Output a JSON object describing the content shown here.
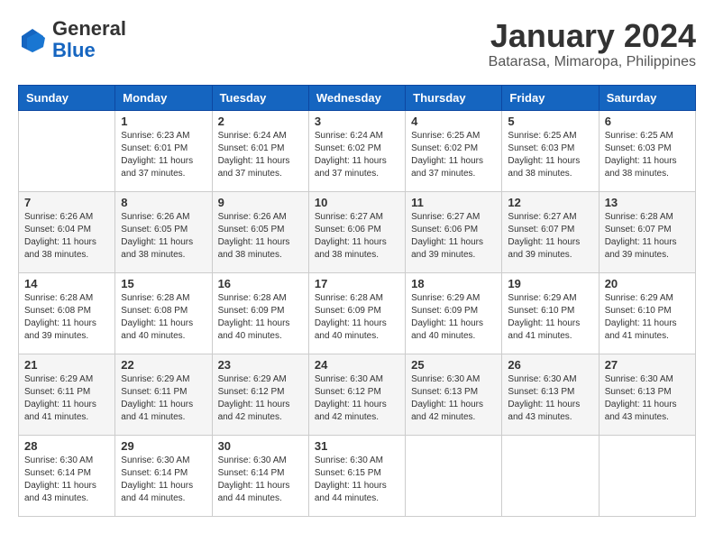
{
  "logo": {
    "general": "General",
    "blue": "Blue"
  },
  "title": "January 2024",
  "location": "Batarasa, Mimaropa, Philippines",
  "days_of_week": [
    "Sunday",
    "Monday",
    "Tuesday",
    "Wednesday",
    "Thursday",
    "Friday",
    "Saturday"
  ],
  "weeks": [
    [
      {
        "day": "",
        "sunrise": "",
        "sunset": "",
        "daylight": ""
      },
      {
        "day": "1",
        "sunrise": "Sunrise: 6:23 AM",
        "sunset": "Sunset: 6:01 PM",
        "daylight": "Daylight: 11 hours and 37 minutes."
      },
      {
        "day": "2",
        "sunrise": "Sunrise: 6:24 AM",
        "sunset": "Sunset: 6:01 PM",
        "daylight": "Daylight: 11 hours and 37 minutes."
      },
      {
        "day": "3",
        "sunrise": "Sunrise: 6:24 AM",
        "sunset": "Sunset: 6:02 PM",
        "daylight": "Daylight: 11 hours and 37 minutes."
      },
      {
        "day": "4",
        "sunrise": "Sunrise: 6:25 AM",
        "sunset": "Sunset: 6:02 PM",
        "daylight": "Daylight: 11 hours and 37 minutes."
      },
      {
        "day": "5",
        "sunrise": "Sunrise: 6:25 AM",
        "sunset": "Sunset: 6:03 PM",
        "daylight": "Daylight: 11 hours and 38 minutes."
      },
      {
        "day": "6",
        "sunrise": "Sunrise: 6:25 AM",
        "sunset": "Sunset: 6:03 PM",
        "daylight": "Daylight: 11 hours and 38 minutes."
      }
    ],
    [
      {
        "day": "7",
        "sunrise": "Sunrise: 6:26 AM",
        "sunset": "Sunset: 6:04 PM",
        "daylight": "Daylight: 11 hours and 38 minutes."
      },
      {
        "day": "8",
        "sunrise": "Sunrise: 6:26 AM",
        "sunset": "Sunset: 6:05 PM",
        "daylight": "Daylight: 11 hours and 38 minutes."
      },
      {
        "day": "9",
        "sunrise": "Sunrise: 6:26 AM",
        "sunset": "Sunset: 6:05 PM",
        "daylight": "Daylight: 11 hours and 38 minutes."
      },
      {
        "day": "10",
        "sunrise": "Sunrise: 6:27 AM",
        "sunset": "Sunset: 6:06 PM",
        "daylight": "Daylight: 11 hours and 38 minutes."
      },
      {
        "day": "11",
        "sunrise": "Sunrise: 6:27 AM",
        "sunset": "Sunset: 6:06 PM",
        "daylight": "Daylight: 11 hours and 39 minutes."
      },
      {
        "day": "12",
        "sunrise": "Sunrise: 6:27 AM",
        "sunset": "Sunset: 6:07 PM",
        "daylight": "Daylight: 11 hours and 39 minutes."
      },
      {
        "day": "13",
        "sunrise": "Sunrise: 6:28 AM",
        "sunset": "Sunset: 6:07 PM",
        "daylight": "Daylight: 11 hours and 39 minutes."
      }
    ],
    [
      {
        "day": "14",
        "sunrise": "Sunrise: 6:28 AM",
        "sunset": "Sunset: 6:08 PM",
        "daylight": "Daylight: 11 hours and 39 minutes."
      },
      {
        "day": "15",
        "sunrise": "Sunrise: 6:28 AM",
        "sunset": "Sunset: 6:08 PM",
        "daylight": "Daylight: 11 hours and 40 minutes."
      },
      {
        "day": "16",
        "sunrise": "Sunrise: 6:28 AM",
        "sunset": "Sunset: 6:09 PM",
        "daylight": "Daylight: 11 hours and 40 minutes."
      },
      {
        "day": "17",
        "sunrise": "Sunrise: 6:28 AM",
        "sunset": "Sunset: 6:09 PM",
        "daylight": "Daylight: 11 hours and 40 minutes."
      },
      {
        "day": "18",
        "sunrise": "Sunrise: 6:29 AM",
        "sunset": "Sunset: 6:09 PM",
        "daylight": "Daylight: 11 hours and 40 minutes."
      },
      {
        "day": "19",
        "sunrise": "Sunrise: 6:29 AM",
        "sunset": "Sunset: 6:10 PM",
        "daylight": "Daylight: 11 hours and 41 minutes."
      },
      {
        "day": "20",
        "sunrise": "Sunrise: 6:29 AM",
        "sunset": "Sunset: 6:10 PM",
        "daylight": "Daylight: 11 hours and 41 minutes."
      }
    ],
    [
      {
        "day": "21",
        "sunrise": "Sunrise: 6:29 AM",
        "sunset": "Sunset: 6:11 PM",
        "daylight": "Daylight: 11 hours and 41 minutes."
      },
      {
        "day": "22",
        "sunrise": "Sunrise: 6:29 AM",
        "sunset": "Sunset: 6:11 PM",
        "daylight": "Daylight: 11 hours and 41 minutes."
      },
      {
        "day": "23",
        "sunrise": "Sunrise: 6:29 AM",
        "sunset": "Sunset: 6:12 PM",
        "daylight": "Daylight: 11 hours and 42 minutes."
      },
      {
        "day": "24",
        "sunrise": "Sunrise: 6:30 AM",
        "sunset": "Sunset: 6:12 PM",
        "daylight": "Daylight: 11 hours and 42 minutes."
      },
      {
        "day": "25",
        "sunrise": "Sunrise: 6:30 AM",
        "sunset": "Sunset: 6:13 PM",
        "daylight": "Daylight: 11 hours and 42 minutes."
      },
      {
        "day": "26",
        "sunrise": "Sunrise: 6:30 AM",
        "sunset": "Sunset: 6:13 PM",
        "daylight": "Daylight: 11 hours and 43 minutes."
      },
      {
        "day": "27",
        "sunrise": "Sunrise: 6:30 AM",
        "sunset": "Sunset: 6:13 PM",
        "daylight": "Daylight: 11 hours and 43 minutes."
      }
    ],
    [
      {
        "day": "28",
        "sunrise": "Sunrise: 6:30 AM",
        "sunset": "Sunset: 6:14 PM",
        "daylight": "Daylight: 11 hours and 43 minutes."
      },
      {
        "day": "29",
        "sunrise": "Sunrise: 6:30 AM",
        "sunset": "Sunset: 6:14 PM",
        "daylight": "Daylight: 11 hours and 44 minutes."
      },
      {
        "day": "30",
        "sunrise": "Sunrise: 6:30 AM",
        "sunset": "Sunset: 6:14 PM",
        "daylight": "Daylight: 11 hours and 44 minutes."
      },
      {
        "day": "31",
        "sunrise": "Sunrise: 6:30 AM",
        "sunset": "Sunset: 6:15 PM",
        "daylight": "Daylight: 11 hours and 44 minutes."
      },
      {
        "day": "",
        "sunrise": "",
        "sunset": "",
        "daylight": ""
      },
      {
        "day": "",
        "sunrise": "",
        "sunset": "",
        "daylight": ""
      },
      {
        "day": "",
        "sunrise": "",
        "sunset": "",
        "daylight": ""
      }
    ]
  ]
}
